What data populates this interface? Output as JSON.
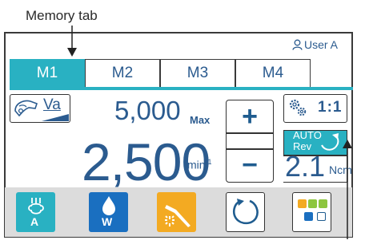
{
  "annotations": {
    "memory_tab": "Memory tab"
  },
  "header": {
    "user_label": "User A"
  },
  "tabs": [
    {
      "label": "M1",
      "active": true
    },
    {
      "label": "M2",
      "active": false
    },
    {
      "label": "M3",
      "active": false
    },
    {
      "label": "M4",
      "active": false
    }
  ],
  "motor": {
    "mode_label": "Va",
    "max_speed": "5,000",
    "max_label": "Max",
    "speed": "2,500",
    "speed_unit": "min",
    "speed_unit_exp": "-1"
  },
  "stepper": {
    "plus": "+",
    "minus": "−"
  },
  "gear": {
    "ratio": "1:1"
  },
  "auto_reverse": {
    "line1": "AUTO",
    "line2": "Rev"
  },
  "torque": {
    "value": "2.1",
    "unit": "Ncm"
  },
  "bottom": {
    "air_label": "A",
    "water_label": "W"
  },
  "colors": {
    "accent": "#29b1c2",
    "water": "#1a6fc0",
    "light": "#f3aa22",
    "text": "#2b5b8f"
  }
}
